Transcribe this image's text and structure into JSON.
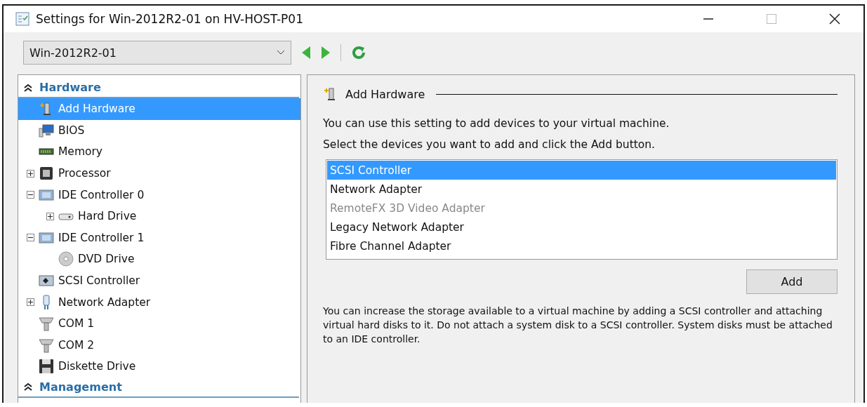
{
  "window": {
    "title": "Settings for Win-2012R2-01 on HV-HOST-P01"
  },
  "toolbar": {
    "vm_select": {
      "value": "Win-2012R2-01"
    },
    "back_disabled": false,
    "forward_disabled": false
  },
  "tree": {
    "sections": [
      {
        "label": "Hardware",
        "expanded": true,
        "items": [
          {
            "label": "Add Hardware",
            "kind": "add-hardware",
            "selected": true
          },
          {
            "label": "BIOS",
            "kind": "bios",
            "selected": false
          },
          {
            "label": "Memory",
            "kind": "memory",
            "selected": false
          },
          {
            "label": "Processor",
            "kind": "processor",
            "selected": false,
            "expanded": false
          },
          {
            "label": "IDE Controller 0",
            "kind": "ide",
            "selected": false,
            "expanded": true,
            "children": [
              {
                "label": "Hard Drive",
                "kind": "disk",
                "selected": false,
                "expanded": false
              }
            ]
          },
          {
            "label": "IDE Controller 1",
            "kind": "ide",
            "selected": false,
            "expanded": true,
            "children": [
              {
                "label": "DVD Drive",
                "kind": "dvd",
                "selected": false
              }
            ]
          },
          {
            "label": "SCSI Controller",
            "kind": "scsi",
            "selected": false
          },
          {
            "label": "Network Adapter",
            "kind": "network",
            "selected": false,
            "expanded": false
          },
          {
            "label": "COM 1",
            "kind": "com",
            "selected": false
          },
          {
            "label": "COM 2",
            "kind": "com",
            "selected": false
          },
          {
            "label": "Diskette Drive",
            "kind": "diskette",
            "selected": false
          }
        ]
      },
      {
        "label": "Management",
        "expanded": true
      }
    ]
  },
  "panel": {
    "title": "Add Hardware",
    "intro": "You can use this setting to add devices to your virtual machine.",
    "instruction": "Select the devices you want to add and click the Add button.",
    "devices": [
      {
        "label": "SCSI Controller",
        "selected": true,
        "disabled": false
      },
      {
        "label": "Network Adapter",
        "selected": false,
        "disabled": false
      },
      {
        "label": "RemoteFX 3D Video Adapter",
        "selected": false,
        "disabled": true
      },
      {
        "label": "Legacy Network Adapter",
        "selected": false,
        "disabled": false
      },
      {
        "label": "Fibre Channel Adapter",
        "selected": false,
        "disabled": false
      }
    ],
    "add_button": "Add",
    "note": "You can increase the storage available to a virtual machine by adding a SCSI controller and attaching virtual hard disks to it. Do not attach a system disk to a SCSI controller. System disks must be attached to an IDE controller."
  }
}
